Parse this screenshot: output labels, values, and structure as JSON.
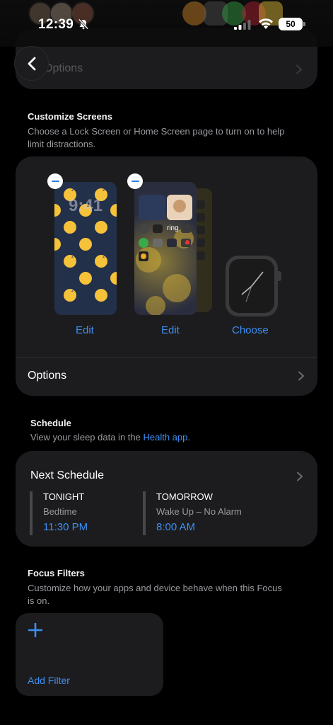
{
  "status_bar": {
    "time": "12:39",
    "battery": "50"
  },
  "top_card": {
    "label": "Options"
  },
  "customize": {
    "title": "Customize Screens",
    "description_line1": "Choose a Lock Screen or Home Screen page to turn on to help",
    "description_line2": "limit distractions.",
    "lock_preview_time": "9:41",
    "home_widget_text": "ring",
    "lock_action": "Edit",
    "home_action": "Edit",
    "watch_action": "Choose",
    "options_label": "Options"
  },
  "schedule": {
    "title": "Schedule",
    "description": "View your sleep data in the ",
    "link": "Health app",
    "period": ".",
    "card_title": "Next Schedule",
    "tonight": {
      "heading": "TONIGHT",
      "label": "Bedtime",
      "time": "11:30 PM"
    },
    "tomorrow": {
      "heading": "TOMORROW",
      "label": "Wake Up – No Alarm",
      "time": "8:00 AM"
    }
  },
  "filters": {
    "title": "Focus Filters",
    "description_line1": "Customize how your apps and device behave when this Focus",
    "description_line2": "is on.",
    "add_label": "Add Filter"
  },
  "colors": {
    "accent": "#3d8ff2",
    "card": "#1c1c1e",
    "background": "#000000"
  }
}
